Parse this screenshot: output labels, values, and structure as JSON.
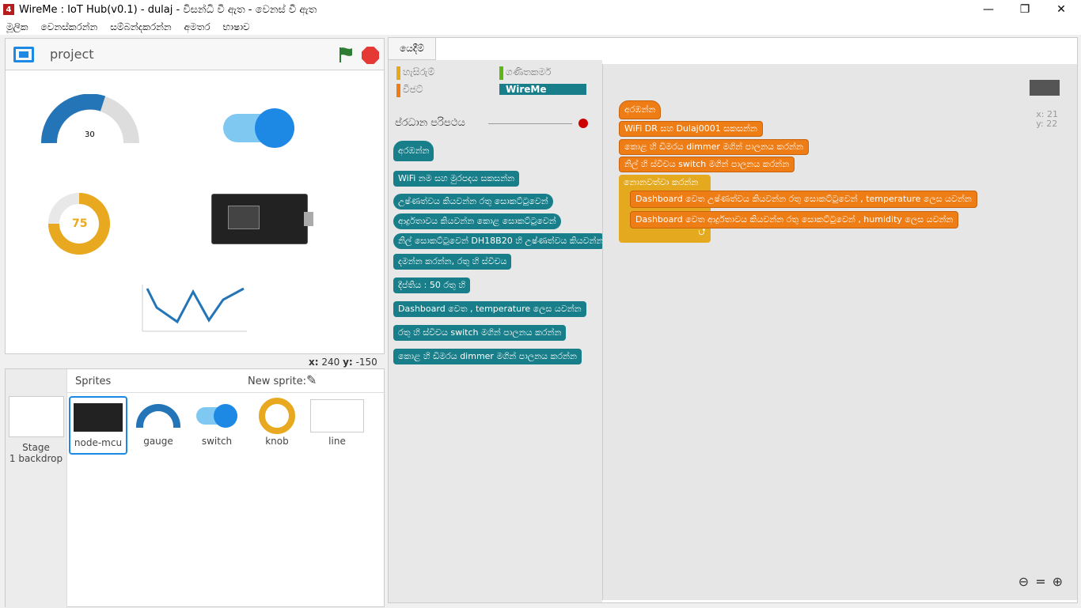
{
  "window": {
    "title": "WireMe : IoT Hub(v0.1) - dulaj - විසන්ධි වී ඇත - වෙනස් වී ඇත",
    "minimize": "—",
    "restore": "❐",
    "close": "✕"
  },
  "menu": [
    "මූලික",
    "වෙනස්කරන්න",
    "සම්බන්දකරන්න",
    "අමතර",
    "භාෂාව"
  ],
  "stage": {
    "project_name": "project",
    "gauge_value": "30",
    "knob_value": "75"
  },
  "coords": {
    "x_label": "x:",
    "x": "240",
    "y_label": "y:",
    "y": "-150"
  },
  "sprites": {
    "header": "Sprites",
    "new_sprite": "New sprite:",
    "stage_label": "Stage",
    "backdrop": "1 backdrop",
    "items": [
      "node-mcu",
      "gauge",
      "switch",
      "knob",
      "line"
    ]
  },
  "scripts": {
    "tab": "යෙදීම්",
    "categories": [
      "හැසිරුම්",
      "ගණිතකර්ම",
      "විජට්",
      "WireMe"
    ],
    "palette_title": "ප්රධාන පරිපථය",
    "canvas_xy": {
      "x": "x: 21",
      "y": "y: 22"
    },
    "palette_blocks": [
      "අරඹන්න",
      "WiFi නම සහ මුරපදය සකසන්න",
      "උෂ්ණත්වය කියවන්න රතු සොකට්ටුවෙන්",
      "ආර්ද්‍රතාවය කියවන්න කොළ සොකට්ටුවෙන්",
      "නිල් සොකට්ටුවෙන් DH18B20 හි උෂ්ණත්වය කියවන්න",
      "දමන්න කරන්න, රතු හි ස්විචය",
      "දීප්තිය : 50 රතු හි",
      "Dashboard වෙත , temperature ලෙස යවන්න",
      "රතු හි ස්විචය switch මගින් පාලනය කරන්න",
      "කොළ හි ඩිමරය dimmer මගින් පාලනය කරන්න"
    ],
    "script_blocks": [
      "අරඹන්න",
      "WiFi DR සහ Dulaj0001 සකසන්න",
      "කොළ හි ඩිමරය dimmer මගින් පාලනය කරන්න",
      "නිල් හි ස්විචය switch මගින් පාලනය කරන්න",
      "නොනවත්වා කරන්න",
      "Dashboard වෙත උෂ්ණත්වය කියවන්න රතු සොකට්ටුවෙන් , temperature ලෙස යවන්න",
      "Dashboard වෙත ආර්ද්‍රතාවය කියවන්න රතු සොකට්ටුවෙන් , humidity ලෙස යවන්න"
    ]
  }
}
